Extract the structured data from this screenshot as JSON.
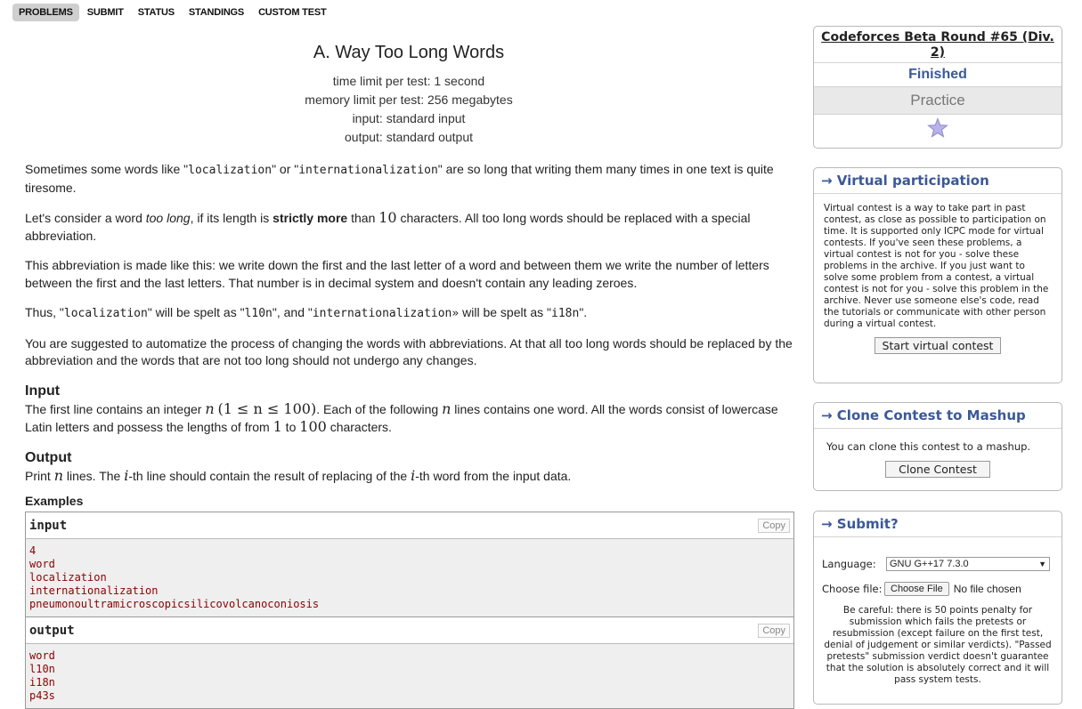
{
  "nav": [
    "PROBLEMS",
    "SUBMIT",
    "STATUS",
    "STANDINGS",
    "CUSTOM TEST"
  ],
  "problem": {
    "title": "A. Way Too Long Words",
    "time_limit": "time limit per test: 1 second",
    "memory_limit": "memory limit per test: 256 megabytes",
    "input": "input: standard input",
    "output": "output: standard output"
  },
  "statement": {
    "p1_a": "Sometimes some words like \"",
    "p1_w1": "localization",
    "p1_b": "\" or \"",
    "p1_w2": "internationalization",
    "p1_c": "\" are so long that writing them many times in one text is quite tiresome.",
    "p2_a": "Let's consider a word ",
    "p2_em": "too long",
    "p2_b": ", if its length is ",
    "p2_strong": "strictly more",
    "p2_c": " than ",
    "p2_num": "10",
    "p2_d": " characters. All too long words should be replaced with a special abbreviation.",
    "p3": "This abbreviation is made like this: we write down the first and the last letter of a word and between them we write the number of letters between the first and the last letters. That number is in decimal system and doesn't contain any leading zeroes.",
    "p4_a": "Thus, \"",
    "p4_w1": "localization",
    "p4_b": "\" will be spelt as \"",
    "p4_w2": "l10n",
    "p4_c": "\", and \"",
    "p4_w3": "internationalization»",
    "p4_d": " will be spelt as \"",
    "p4_w4": "i18n",
    "p4_e": "\".",
    "p5": "You are suggested to automatize the process of changing the words with abbreviations. At that all too long words should be replaced by the abbreviation and the words that are not too long should not undergo any changes."
  },
  "input_section": {
    "title": "Input",
    "a": "The first line contains an integer ",
    "n": "n",
    "cond": "(1 ≤ n ≤ 100)",
    "b": ". Each of the following ",
    "n2": "n",
    "c": " lines contains one word. All the words consist of lowercase Latin letters and possess the lengths of from ",
    "one": "1",
    "d": " to ",
    "hundred": "100",
    "e": " characters."
  },
  "output_section": {
    "title": "Output",
    "a": "Print ",
    "n": "n",
    "b": " lines. The ",
    "i": "i",
    "c": "-th line should contain the result of replacing of the ",
    "i2": "i",
    "d": "-th word from the input data."
  },
  "examples": {
    "title": "Examples",
    "input_label": "input",
    "output_label": "output",
    "copy": "Copy",
    "input_lines": [
      "4",
      "word",
      "localization",
      "internationalization",
      "pneumonoultramicroscopicsilicovolcanoconiosis"
    ],
    "output_lines": [
      "word",
      "l10n",
      "i18n",
      "p43s"
    ]
  },
  "sidebar": {
    "contest_name": "Codeforces Beta Round #65 (Div. 2)",
    "status": "Finished",
    "mode": "Practice",
    "virtual": {
      "title": "→ Virtual participation",
      "text": "Virtual contest is a way to take part in past contest, as close as possible to participation on time. It is supported only ICPC mode for virtual contests. If you've seen these problems, a virtual contest is not for you - solve these problems in the archive. If you just want to solve some problem from a contest, a virtual contest is not for you - solve this problem in the archive. Never use someone else's code, read the tutorials or communicate with other person during a virtual contest.",
      "button": "Start virtual contest"
    },
    "clone": {
      "title": "→ Clone Contest to Mashup",
      "text": "You can clone this contest to a mashup.",
      "button": "Clone Contest"
    },
    "submit": {
      "title": "→ Submit?",
      "language_label": "Language:",
      "language_value": "GNU G++17 7.3.0",
      "file_label": "Choose file:",
      "file_button": "Choose File",
      "file_status": "No file chosen",
      "warning": "Be careful: there is 50 points penalty for submission which fails the pretests or resubmission (except failure on the first test, denial of judgement or similar verdicts). \"Passed pretests\" submission verdict doesn't guarantee that the solution is absolutely correct and it will pass system tests."
    }
  },
  "colors": {
    "link_blue": "#3b5998",
    "sample_text": "#8b0000"
  }
}
